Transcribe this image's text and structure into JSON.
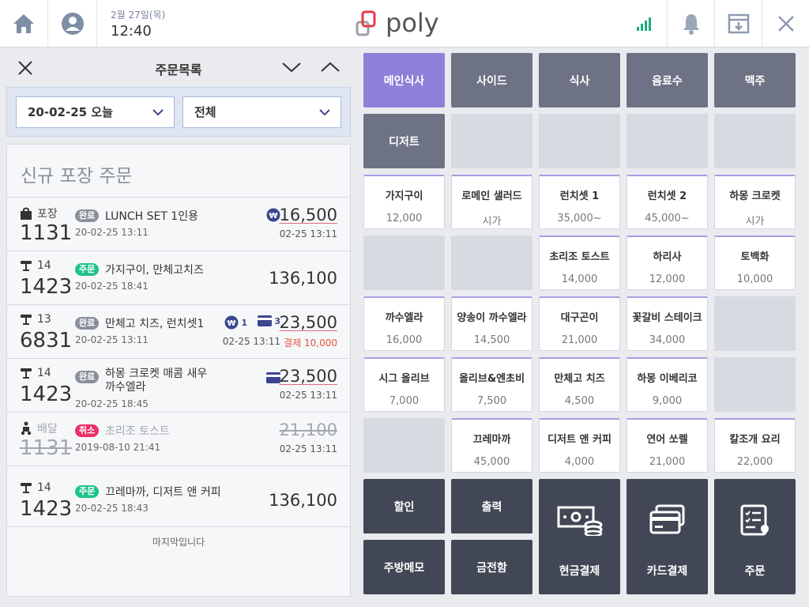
{
  "header": {
    "date": "2월 27일(목)",
    "time": "12:40",
    "brand": "poly"
  },
  "order_panel": {
    "title": "주문목록",
    "filter_date": "20-02-25 오늘",
    "filter_type": "전체",
    "section_title": "신규 포장 주문",
    "last_message": "마지막입니다",
    "orders": [
      {
        "type": "포장",
        "number": "1131",
        "status": "완료",
        "title": "LUNCH SET 1인용",
        "date": "20-02-25  13:11",
        "amount": "16,500",
        "time": "02-25  13:11"
      },
      {
        "type": "14",
        "number": "1423",
        "status": "주문",
        "title": "가지구이, 만체고치즈",
        "date": "20-02-25  18:41",
        "amount": "136,100"
      },
      {
        "type": "13",
        "number": "6831",
        "status": "완료",
        "title": "만체고 치즈, 런치셋1",
        "date": "20-02-25  13:11",
        "amount": "23,500",
        "time": "02-25  13:11",
        "paid": "결제 10,000",
        "cash_count": "1",
        "card_count": "3"
      },
      {
        "type": "14",
        "number": "1423",
        "status": "완료",
        "title": "하몽 크로켓 매콤 새우",
        "title2": "까수엘라",
        "date": "20-02-25  18:45",
        "amount": "23,500",
        "time": "02-25  13:11"
      },
      {
        "type": "배달",
        "number": "1131",
        "status": "취소",
        "title": "초리조 토스트",
        "date": "2019-08-10  21:41",
        "amount": "21,100",
        "time": "02-25  13:11"
      },
      {
        "type": "14",
        "number": "1423",
        "status": "주문",
        "title": "끄레마까, 디저트 앤 커피",
        "date": "20-02-25  18:43",
        "amount": "136,100"
      }
    ]
  },
  "categories": [
    "메인식사",
    "사이드",
    "식사",
    "음료수",
    "맥주",
    "디저트"
  ],
  "menu": [
    {
      "name": "가지구이",
      "price": "12,000"
    },
    {
      "name": "로메인 샐러드",
      "price": "시가"
    },
    {
      "name": "런치셋 1",
      "price": "35,000~"
    },
    {
      "name": "런치셋 2",
      "price": "45,000~"
    },
    {
      "name": "하몽 크로켓",
      "price": "시가"
    },
    {
      "name": "초리조 토스트",
      "price": "14,000"
    },
    {
      "name": "하리사",
      "price": "12,000"
    },
    {
      "name": "토백화",
      "price": "10,000"
    },
    {
      "name": "까수엘라",
      "price": "16,000"
    },
    {
      "name": "양송이 까수엘라",
      "price": "14,500"
    },
    {
      "name": "대구곤이",
      "price": "21,000"
    },
    {
      "name": "꽃갈비 스테이크",
      "price": "34,000"
    },
    {
      "name": "시그 올리브",
      "price": "7,000"
    },
    {
      "name": "올리브&엔초비",
      "price": "7,500"
    },
    {
      "name": "만체고 치즈",
      "price": "4,500"
    },
    {
      "name": "하몽 이베리코",
      "price": "9,000"
    },
    {
      "name": "끄레마까",
      "price": "45,000"
    },
    {
      "name": "디저트 앤 커피",
      "price": "4,000"
    },
    {
      "name": "연어 쏘렐",
      "price": "21,000"
    },
    {
      "name": "칼조개 요리",
      "price": "22,000"
    }
  ],
  "actions": {
    "discount": "할인",
    "print": "출력",
    "kitchen_memo": "주방메모",
    "cash_drawer": "금전함",
    "cash_pay": "현금결제",
    "card_pay": "카드결제",
    "order": "주문"
  },
  "colors": {
    "active_category": "#8c80d8",
    "category": "#6e7285",
    "action": "#414754",
    "status_done": "#8a8f9a",
    "status_order": "#1fc28a",
    "status_cancel": "#ec2f67"
  }
}
